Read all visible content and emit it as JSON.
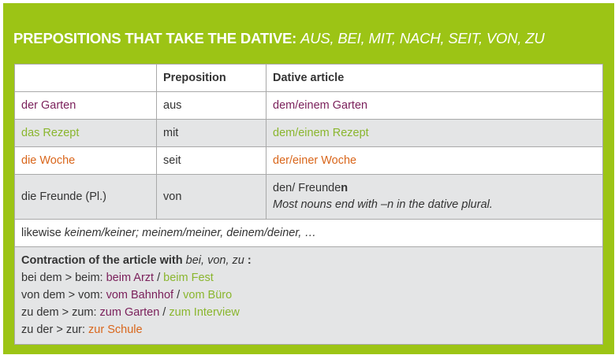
{
  "heading": {
    "bold": "Prepositions that take the dative:",
    "italic": "aus, bei, mit, nach, seit, von, zu"
  },
  "colors": {
    "panel": "#9cc415",
    "purple": "#7a1f5a",
    "green": "#8ab62e",
    "orange": "#d9661b"
  },
  "table": {
    "headers": [
      "",
      "Preposition",
      "Dative article"
    ],
    "rows": [
      {
        "noun": "der Garten",
        "preposition": "aus",
        "article": "dem/einem Garten",
        "color": "purple"
      },
      {
        "noun": "das Rezept",
        "preposition": "mit",
        "article": "dem/einem Rezept",
        "color": "green"
      },
      {
        "noun": "die Woche",
        "preposition": "seit",
        "article": "der/einer Woche",
        "color": "orange"
      },
      {
        "noun": "die Freunde (Pl.)",
        "preposition": "von",
        "article_prefix": "den/ Freunde",
        "article_bold": "n",
        "note": "Most nouns end with –n in the dative plural."
      }
    ],
    "likewise": {
      "prefix": "likewise ",
      "italic": "keinem/keiner; meinem/meiner, deinem/deiner, …"
    },
    "contraction": {
      "title_bold": "Contraction of the article with ",
      "title_italic": "bei, von, zu",
      "title_bold_end": " :",
      "lines": [
        {
          "prefix": "bei dem > beim: ",
          "a": "beim Arzt",
          "sep": " / ",
          "b": "beim Fest",
          "b_color": "green"
        },
        {
          "prefix": "von dem > vom: ",
          "a": "vom Bahnhof",
          "sep": " / ",
          "b": "vom Büro",
          "b_color": "green"
        },
        {
          "prefix": "zu dem > zum: ",
          "a": "zum Garten",
          "sep": " / ",
          "b": "zum Interview",
          "b_color": "green"
        },
        {
          "prefix": "zu der > zur: ",
          "a": "zur Schule",
          "a_color": "orange"
        }
      ]
    }
  }
}
